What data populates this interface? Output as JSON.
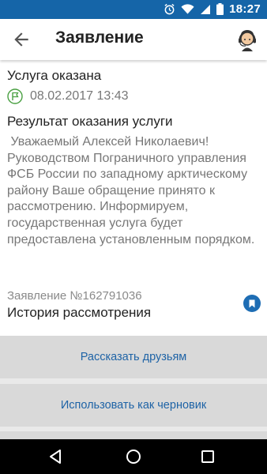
{
  "status_bar": {
    "time": "18:27",
    "icons": [
      "alarm-icon",
      "wifi-icon",
      "cellular-signal-icon",
      "battery-icon"
    ]
  },
  "app_bar": {
    "title": "Заявление",
    "back_icon": "arrow-left-icon",
    "support_icon": "headset-operator-icon"
  },
  "application": {
    "status": "Услуга оказана",
    "status_icon": "flag-icon",
    "status_date": "08.02.2017 13:43",
    "result_heading": "Результат оказания услуги",
    "result_text": " Уважаемый Алексей Николаевич! Руководством Пограничного управления ФСБ России по западному арктическому району Ваше обращение принято к рассмотрению. Информируем, государственная услуга будет предоставлена установленным порядком.",
    "number": "Заявление №162791036",
    "history_label": "История рассмотрения",
    "bookmark_icon": "bookmark-icon"
  },
  "actions": {
    "share_label": "Рассказать друзьям",
    "draft_label": "Использовать как черновик"
  },
  "nav_bar": {
    "icons": [
      "nav-back-icon",
      "nav-home-icon",
      "nav-recent-apps-icon"
    ]
  },
  "colors": {
    "status_bar": "#1565a8",
    "accent": "#1e63a6",
    "button_bg": "#d9d9d9"
  }
}
